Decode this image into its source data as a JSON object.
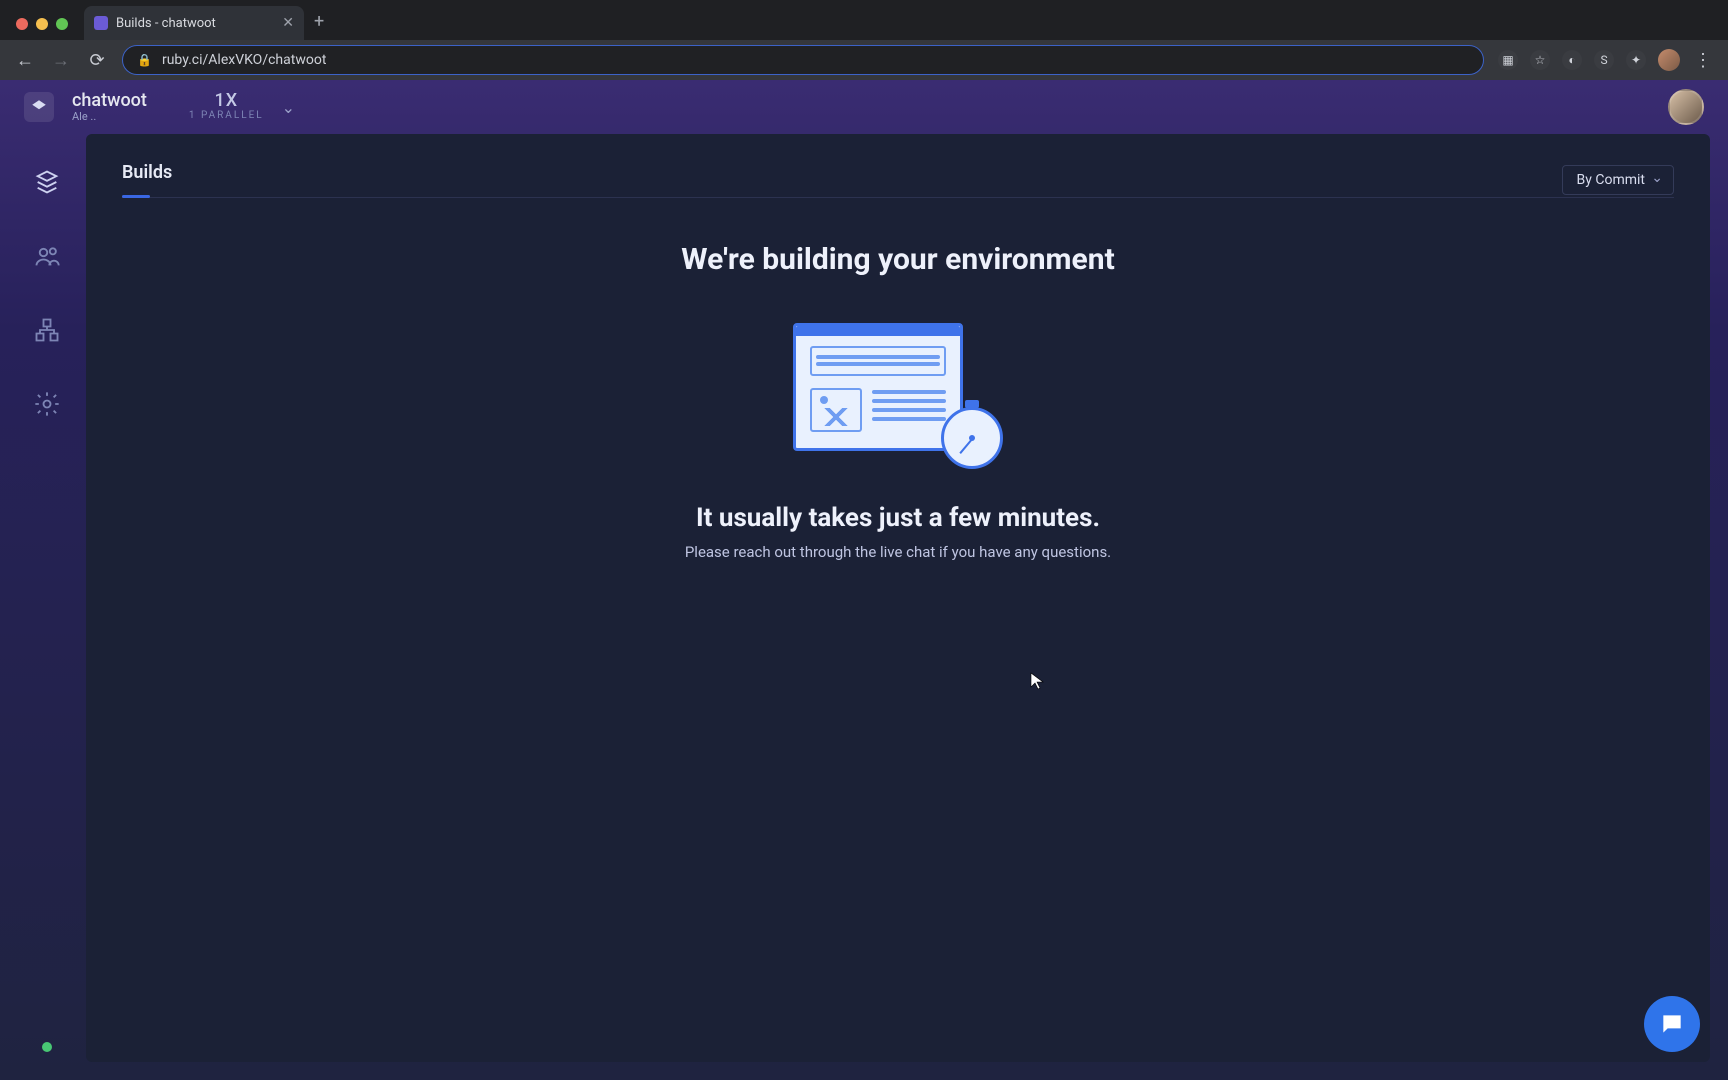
{
  "browser": {
    "tab_title": "Builds - chatwoot",
    "url": "ruby.ci/AlexVKO/chatwoot"
  },
  "app_header": {
    "project_name": "chatwoot",
    "owner_abbrev": "Ale ..",
    "parallel_count": "1X",
    "parallel_label": "1 PARALLEL"
  },
  "sidenav": {
    "items": [
      "builds",
      "team",
      "integrations",
      "settings"
    ]
  },
  "main": {
    "tab_label": "Builds",
    "dropdown_selected": "By Commit",
    "heading": "We're building your environment",
    "subheading": "It usually takes just a few minutes.",
    "paragraph": "Please reach out through the live chat if you have any questions."
  }
}
